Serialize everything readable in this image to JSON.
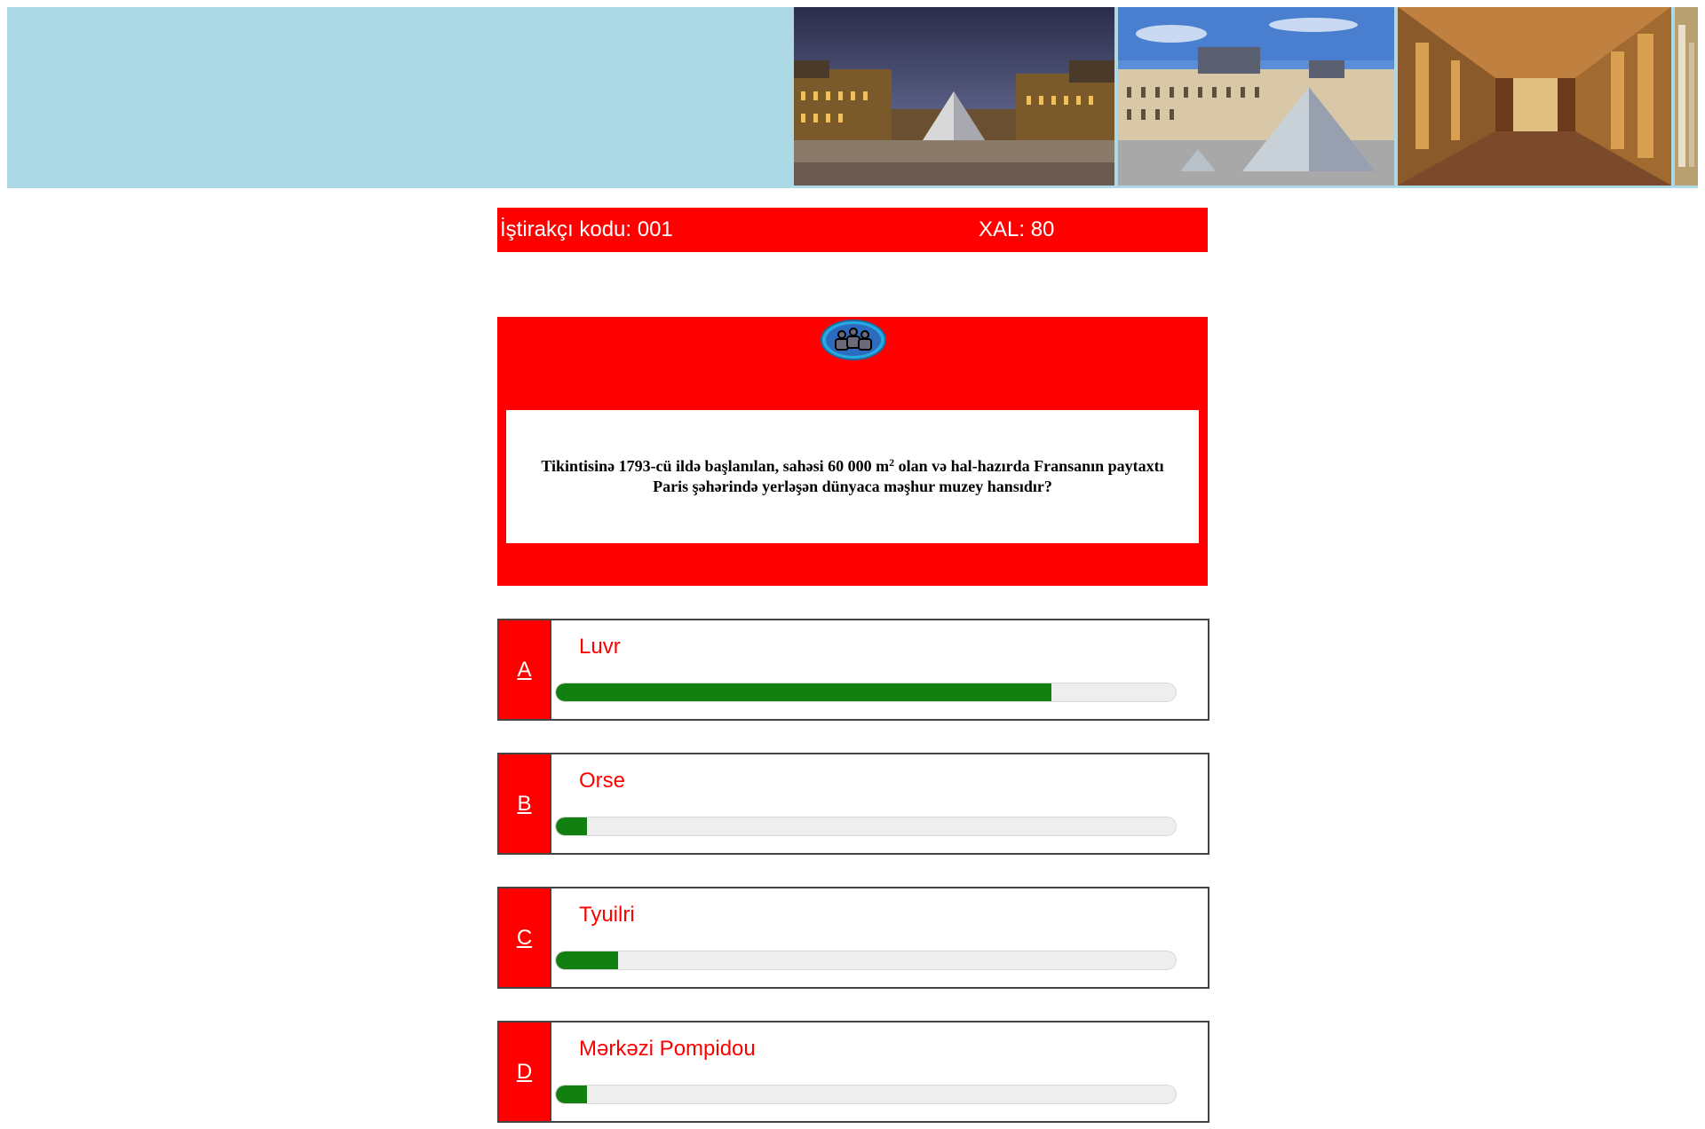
{
  "header": {
    "photos": [
      "louvre-pyramid-night-photo",
      "louvre-pyramid-day-photo",
      "louvre-gallery-interior-photo",
      "louvre-photo-partial"
    ]
  },
  "infobar": {
    "participant_code": "İştirakçı kodu: 001",
    "score": "XAL: 80"
  },
  "question": {
    "lifeline_icon": "audience-icon",
    "text_before_sup": "Tikintisinə 1793-cü ildə başlanılan, sahəsi 60 000 m",
    "sup": "2",
    "text_after_sup": " olan və hal-hazırda Fransanın paytaxtı Paris şəhərində yerləşən dünyaca məşhur muzey hansıdır?"
  },
  "answers": [
    {
      "letter": "A",
      "text": "Luvr",
      "percent": 80
    },
    {
      "letter": "B",
      "text": "Orse",
      "percent": 5
    },
    {
      "letter": "C",
      "text": "Tyuilri",
      "percent": 10
    },
    {
      "letter": "D",
      "text": "Mərkəzi Pompidou",
      "percent": 5
    }
  ],
  "colors": {
    "banner": "#add8e6",
    "panel": "#ff0000",
    "progress_fill": "#118011",
    "progress_track": "#eeeeee"
  }
}
